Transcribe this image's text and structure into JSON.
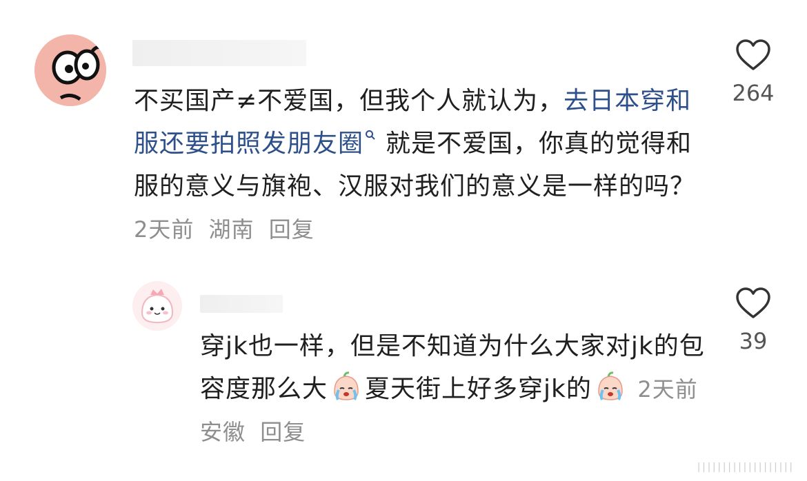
{
  "comments": [
    {
      "text_1": "不买国产≠不爱国，但我个人就认为，",
      "link_text": "去日本穿和服还要拍照发朋友圈",
      "text_2": "就是不爱国，你真的觉得和服的意义与旗袍、汉服对我们的意义是一样的吗？",
      "time": "2天前",
      "location": "湖南",
      "reply_label": "回复",
      "like_count": "264"
    },
    {
      "text_1": "穿jk也一样，但是不知道为什么大家对jk的包容度那么大",
      "text_2": "夏天街上好多穿jk的",
      "time": "2天前",
      "location": "安徽",
      "reply_label": "回复",
      "like_count": "39"
    }
  ],
  "colors": {
    "link": "#2d4f8a",
    "meta": "#8e8e8e",
    "avatar1_bg": "#f3b4a9",
    "avatar2_bg": "#fdeef0"
  },
  "icons": [
    "heart-outline-icon",
    "search-icon",
    "crying-face-emoji"
  ]
}
